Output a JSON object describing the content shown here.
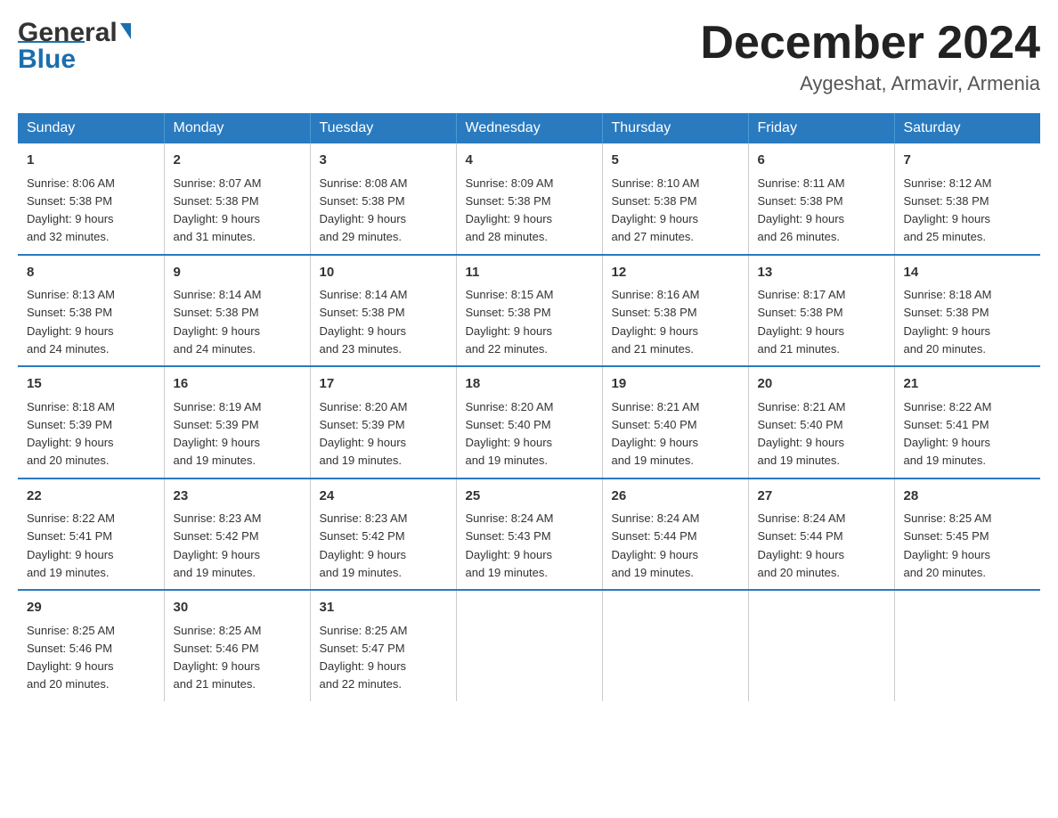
{
  "logo": {
    "general": "General",
    "blue": "Blue",
    "triangle": "▲"
  },
  "header": {
    "month_year": "December 2024",
    "location": "Aygeshat, Armavir, Armenia"
  },
  "days_of_week": [
    "Sunday",
    "Monday",
    "Tuesday",
    "Wednesday",
    "Thursday",
    "Friday",
    "Saturday"
  ],
  "weeks": [
    [
      {
        "day": "1",
        "sunrise": "8:06 AM",
        "sunset": "5:38 PM",
        "daylight": "9 hours and 32 minutes."
      },
      {
        "day": "2",
        "sunrise": "8:07 AM",
        "sunset": "5:38 PM",
        "daylight": "9 hours and 31 minutes."
      },
      {
        "day": "3",
        "sunrise": "8:08 AM",
        "sunset": "5:38 PM",
        "daylight": "9 hours and 29 minutes."
      },
      {
        "day": "4",
        "sunrise": "8:09 AM",
        "sunset": "5:38 PM",
        "daylight": "9 hours and 28 minutes."
      },
      {
        "day": "5",
        "sunrise": "8:10 AM",
        "sunset": "5:38 PM",
        "daylight": "9 hours and 27 minutes."
      },
      {
        "day": "6",
        "sunrise": "8:11 AM",
        "sunset": "5:38 PM",
        "daylight": "9 hours and 26 minutes."
      },
      {
        "day": "7",
        "sunrise": "8:12 AM",
        "sunset": "5:38 PM",
        "daylight": "9 hours and 25 minutes."
      }
    ],
    [
      {
        "day": "8",
        "sunrise": "8:13 AM",
        "sunset": "5:38 PM",
        "daylight": "9 hours and 24 minutes."
      },
      {
        "day": "9",
        "sunrise": "8:14 AM",
        "sunset": "5:38 PM",
        "daylight": "9 hours and 24 minutes."
      },
      {
        "day": "10",
        "sunrise": "8:14 AM",
        "sunset": "5:38 PM",
        "daylight": "9 hours and 23 minutes."
      },
      {
        "day": "11",
        "sunrise": "8:15 AM",
        "sunset": "5:38 PM",
        "daylight": "9 hours and 22 minutes."
      },
      {
        "day": "12",
        "sunrise": "8:16 AM",
        "sunset": "5:38 PM",
        "daylight": "9 hours and 21 minutes."
      },
      {
        "day": "13",
        "sunrise": "8:17 AM",
        "sunset": "5:38 PM",
        "daylight": "9 hours and 21 minutes."
      },
      {
        "day": "14",
        "sunrise": "8:18 AM",
        "sunset": "5:38 PM",
        "daylight": "9 hours and 20 minutes."
      }
    ],
    [
      {
        "day": "15",
        "sunrise": "8:18 AM",
        "sunset": "5:39 PM",
        "daylight": "9 hours and 20 minutes."
      },
      {
        "day": "16",
        "sunrise": "8:19 AM",
        "sunset": "5:39 PM",
        "daylight": "9 hours and 19 minutes."
      },
      {
        "day": "17",
        "sunrise": "8:20 AM",
        "sunset": "5:39 PM",
        "daylight": "9 hours and 19 minutes."
      },
      {
        "day": "18",
        "sunrise": "8:20 AM",
        "sunset": "5:40 PM",
        "daylight": "9 hours and 19 minutes."
      },
      {
        "day": "19",
        "sunrise": "8:21 AM",
        "sunset": "5:40 PM",
        "daylight": "9 hours and 19 minutes."
      },
      {
        "day": "20",
        "sunrise": "8:21 AM",
        "sunset": "5:40 PM",
        "daylight": "9 hours and 19 minutes."
      },
      {
        "day": "21",
        "sunrise": "8:22 AM",
        "sunset": "5:41 PM",
        "daylight": "9 hours and 19 minutes."
      }
    ],
    [
      {
        "day": "22",
        "sunrise": "8:22 AM",
        "sunset": "5:41 PM",
        "daylight": "9 hours and 19 minutes."
      },
      {
        "day": "23",
        "sunrise": "8:23 AM",
        "sunset": "5:42 PM",
        "daylight": "9 hours and 19 minutes."
      },
      {
        "day": "24",
        "sunrise": "8:23 AM",
        "sunset": "5:42 PM",
        "daylight": "9 hours and 19 minutes."
      },
      {
        "day": "25",
        "sunrise": "8:24 AM",
        "sunset": "5:43 PM",
        "daylight": "9 hours and 19 minutes."
      },
      {
        "day": "26",
        "sunrise": "8:24 AM",
        "sunset": "5:44 PM",
        "daylight": "9 hours and 19 minutes."
      },
      {
        "day": "27",
        "sunrise": "8:24 AM",
        "sunset": "5:44 PM",
        "daylight": "9 hours and 20 minutes."
      },
      {
        "day": "28",
        "sunrise": "8:25 AM",
        "sunset": "5:45 PM",
        "daylight": "9 hours and 20 minutes."
      }
    ],
    [
      {
        "day": "29",
        "sunrise": "8:25 AM",
        "sunset": "5:46 PM",
        "daylight": "9 hours and 20 minutes."
      },
      {
        "day": "30",
        "sunrise": "8:25 AM",
        "sunset": "5:46 PM",
        "daylight": "9 hours and 21 minutes."
      },
      {
        "day": "31",
        "sunrise": "8:25 AM",
        "sunset": "5:47 PM",
        "daylight": "9 hours and 22 minutes."
      },
      null,
      null,
      null,
      null
    ]
  ],
  "labels": {
    "sunrise": "Sunrise:",
    "sunset": "Sunset:",
    "daylight": "Daylight:"
  }
}
